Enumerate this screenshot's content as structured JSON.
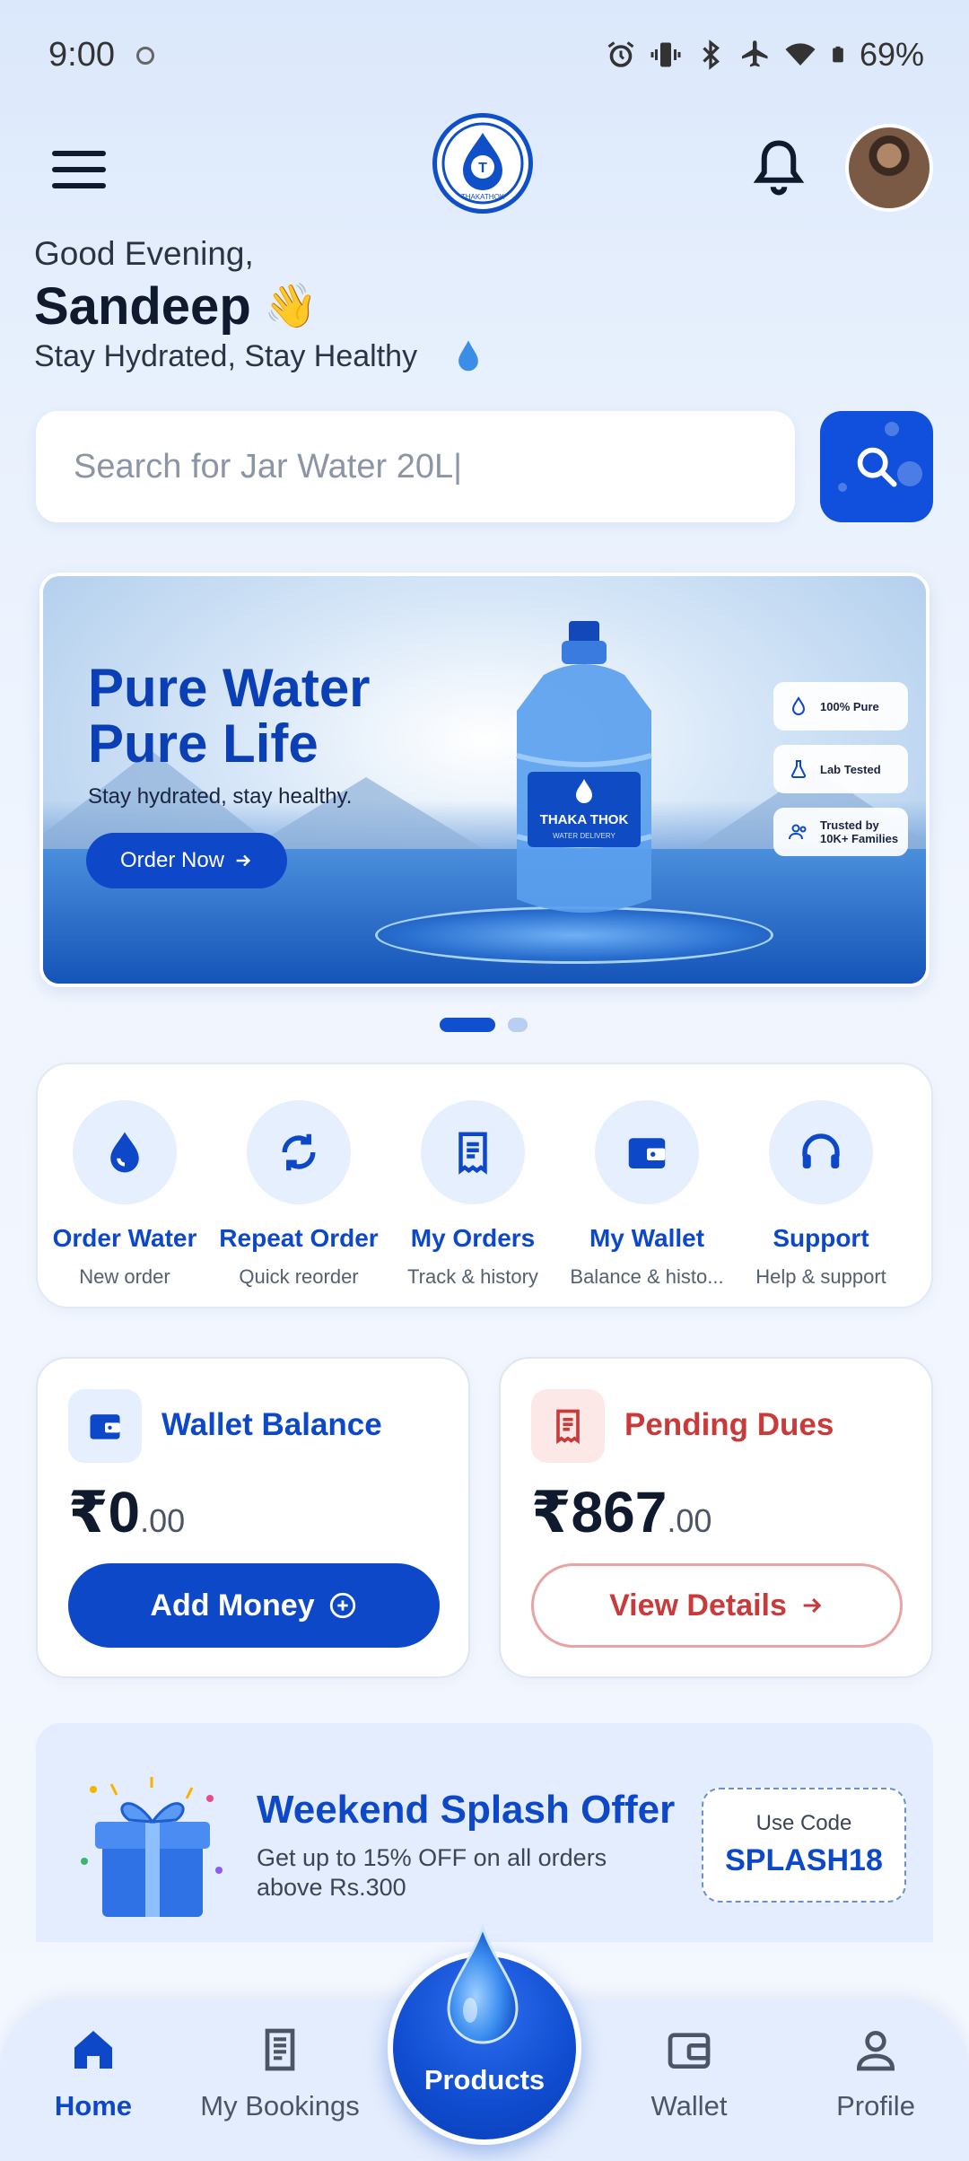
{
  "status_bar": {
    "time": "9:00",
    "battery": "69%"
  },
  "header": {
    "logo_text": "THAKATHOK",
    "logo_letter": "T"
  },
  "greeting": {
    "salutation": "Good Evening,",
    "name": "Sandeep",
    "wave": "👋",
    "tagline": "Stay Hydrated, Stay Healthy"
  },
  "search": {
    "placeholder": "Search for Jar Water 20L|"
  },
  "banner": {
    "title_line1": "Pure Water",
    "title_line2": "Pure Life",
    "subtitle": "Stay hydrated, stay healthy.",
    "cta": "Order Now",
    "jug_brand": "THAKA THOK",
    "jug_sub": "WATER DELIVERY",
    "badges": [
      "100% Pure",
      "Lab Tested",
      "Trusted by 10K+ Families"
    ],
    "slide_count": 2,
    "active_slide": 1
  },
  "quick_actions": [
    {
      "label": "Order Water",
      "sub": "New order",
      "icon": "water-drop-icon"
    },
    {
      "label": "Repeat Order",
      "sub": "Quick reorder",
      "icon": "repeat-icon"
    },
    {
      "label": "My Orders",
      "sub": "Track & history",
      "icon": "receipt-icon"
    },
    {
      "label": "My Wallet",
      "sub": "Balance & histo...",
      "icon": "wallet-icon"
    },
    {
      "label": "Support",
      "sub": "Help & support",
      "icon": "headset-icon"
    }
  ],
  "wallet_card": {
    "title": "Wallet Balance",
    "amount_main": "₹0",
    "amount_decimal": ".00",
    "cta": "Add Money",
    "accent": "#0c48c8"
  },
  "dues_card": {
    "title": "Pending Dues",
    "amount_main": "₹867",
    "amount_decimal": ".00",
    "cta": "View Details",
    "accent": "#c93a3a"
  },
  "offer": {
    "title": "Weekend Splash Offer",
    "description": "Get up to 15% OFF on all orders above Rs.300",
    "code_label": "Use Code",
    "code": "SPLASH18"
  },
  "bottom_nav": {
    "home": "Home",
    "bookings": "My Bookings",
    "products": "Products",
    "wallet": "Wallet",
    "profile": "Profile"
  },
  "colors": {
    "primary": "#1050dc",
    "danger": "#c93a3a",
    "background": "#eaf1fd"
  }
}
